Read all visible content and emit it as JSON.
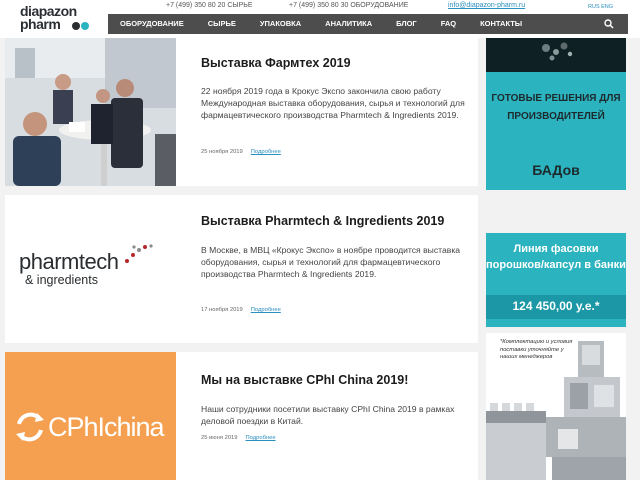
{
  "header": {
    "logo_line1": "diapazon",
    "logo_line2": "pharm",
    "phone1": "+7 (499) 350 80 20",
    "phone1_label": "СЫРЬЕ",
    "phone2": "+7 (499) 350 80 30",
    "phone2_label": "ОБОРУДОВАНИЕ",
    "email": "info@diapazon-pharm.ru",
    "lang": "RUS  ENG"
  },
  "nav": {
    "items": [
      "Оборудование",
      "Сырье",
      "Упаковка",
      "Аналитика",
      "Блог",
      "FAQ",
      "Контакты"
    ]
  },
  "cards": [
    {
      "title": "Выставка Фармтех 2019",
      "text": "22 ноября 2019 года в Крокус Экспо закончила свою работу Международная выставка оборудования, сырья и технологий для фармацевтического производства Pharmtech & Ingredients 2019.",
      "date": "25 ноября 2019",
      "more": "Подробнее"
    },
    {
      "title": "Выставка Pharmtech & Ingredients 2019",
      "text": "В Москве, в МВЦ «Крокус Экспо» в ноябре проводится выставка оборудования, сырья и технологий для фармацевтического производства Pharmtech & Ingredients 2019.",
      "date": "17 ноября 2019",
      "more": "Подробнее",
      "logo_line1": "pharmtech",
      "logo_line2": "& ingredients"
    },
    {
      "title": "Мы на выставке CPhI China 2019!",
      "text": "Наши сотрудники посетили выставку CPhI China 2019 в рамках деловой поездки в Китай.",
      "date": "25 июня 2019",
      "more": "Подробнее",
      "logo_cphi": "CPhI",
      "logo_china": "china"
    }
  ],
  "ads": {
    "ad1_text": "ГОТОВЫЕ РЕШЕНИЯ ДЛЯ ПРОИЗВОДИТЕЛЕЙ",
    "ad1_big": "БАДов",
    "ad2_text": "Линия фасовки порошков/капсул в банки",
    "ad2_price": "124 450,00 у.е.*",
    "ad3_note": "*Комплектацию и условия поставки уточняйте у наших менеджеров"
  },
  "colors": {
    "accent": "#2a8fc1",
    "teal": "#2cb3c0",
    "nav_bg": "#4d4d4d",
    "cphi_orange": "#f5a050"
  }
}
